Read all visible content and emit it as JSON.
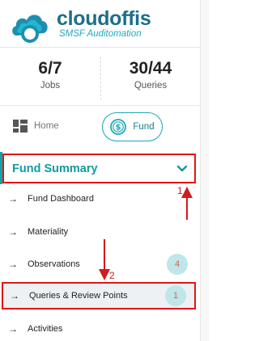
{
  "brand": {
    "name": "cloudoffis",
    "tagline": "SMSF Auditomation",
    "colors": {
      "primary": "#1c6f88",
      "accent": "#16aab8",
      "highlight": "#e01616"
    }
  },
  "stats": [
    {
      "value": "6/7",
      "label": "Jobs"
    },
    {
      "value": "30/44",
      "label": "Queries"
    }
  ],
  "nav": {
    "home_label": "Home",
    "fund_label": "Fund",
    "home_icon": "dashboard-grid-icon",
    "fund_icon": "dollar-coin-icon"
  },
  "section": {
    "title": "Fund Summary",
    "expand_icon": "chevron-down-icon"
  },
  "menu": [
    {
      "label": "Fund Dashboard",
      "badge": ""
    },
    {
      "label": "Materiality",
      "badge": ""
    },
    {
      "label": "Observations",
      "badge": "4"
    },
    {
      "label": "Queries & Review Points",
      "badge": "1"
    },
    {
      "label": "Activities",
      "badge": ""
    }
  ],
  "annotations": {
    "step1": "1",
    "step2": "2"
  }
}
